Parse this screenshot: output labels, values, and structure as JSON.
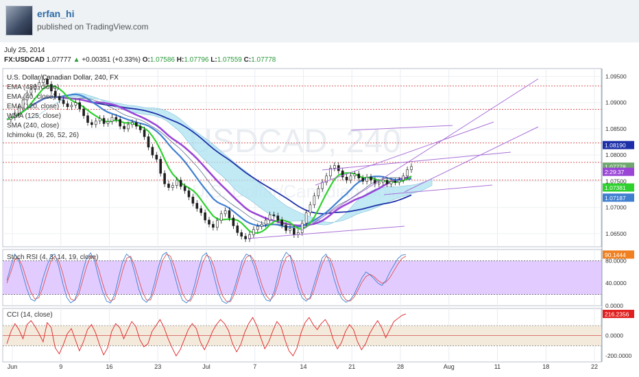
{
  "header": {
    "username": "erfan_hi",
    "published": "published on TradingView.com",
    "date": "July 25, 2014"
  },
  "quote": {
    "symbol": "FX:USDCAD",
    "last": "1.07777",
    "change": "+0.00351 (+0.33%)",
    "o_label": "O:",
    "o": "1.07586",
    "h_label": "H:",
    "h": "1.07796",
    "l_label": "L:",
    "l": "1.07559",
    "c_label": "C:",
    "c": "1.07778"
  },
  "pane_title": "U.S. Dollar/Canadian Dollar, 240, FX",
  "watermark": {
    "main": "USDCAD, 240",
    "sub": "U.S. Dollar/Canadian Dollar"
  },
  "indicators": [
    "EMA (480, close)",
    "EMA (40, close)",
    "EMA (120, close)",
    "WMA (125, close)",
    "SMA (240, close)",
    "Ichimoku (9, 26, 52, 26)"
  ],
  "stoch_title": "Stoch RSI (4, 3, 14, 19, close)",
  "cci_title": "CCI (14, close)",
  "colors": {
    "price": "#1e1e1e",
    "ema480": "#1c2fa8",
    "ema120": "#9a45d6",
    "ema40": "#2ed12e",
    "wma": "#3f7fd0",
    "sma": "#5a6f8a",
    "cloud": "#aee3f2",
    "level": "#cc2222",
    "trend": "#a86fd6",
    "stoch_fill": "#e2ccff",
    "cci_fill": "#f3eadc",
    "cci": "#e02020"
  },
  "chart_data": {
    "type": "line",
    "x_ticks": [
      "Jun",
      "9",
      "16",
      "23",
      "Jul",
      "7",
      "14",
      "21",
      "28",
      "Aug",
      "11",
      "18",
      "22"
    ],
    "price_axis": {
      "ticks": [
        "1.09500",
        "1.09000",
        "1.08500",
        "1.08000",
        "1.07500",
        "1.07000",
        "1.06500"
      ],
      "ylim": [
        1.0625,
        1.0965
      ],
      "labels": [
        {
          "text": "1.08190",
          "value": 1.0819,
          "color": "#1c2fa8"
        },
        {
          "text": "1.07778",
          "value": 1.07778,
          "color": "#6ea86e"
        },
        {
          "text": "2:29:37",
          "value": 1.0768,
          "color": "#9a45d6"
        },
        {
          "text": "1.07381",
          "value": 1.07381,
          "color": "#2ed12e"
        },
        {
          "text": "1.07187",
          "value": 1.07187,
          "color": "#3f7fd0"
        }
      ],
      "levels": [
        1.0932,
        1.0887,
        1.0823,
        1.0786,
        1.0752
      ]
    },
    "price_series": [
      1.0868,
      1.0872,
      1.088,
      1.089,
      1.0905,
      1.0918,
      1.0925,
      1.093,
      1.0938,
      1.0945,
      1.0935,
      1.0922,
      1.0912,
      1.0905,
      1.0898,
      1.0892,
      1.0895,
      1.09,
      1.0888,
      1.0875,
      1.0862,
      1.0858,
      1.0865,
      1.087,
      1.086,
      1.0864,
      1.0872,
      1.0868,
      1.0855,
      1.085,
      1.0858,
      1.0862,
      1.0855,
      1.0848,
      1.0835,
      1.0815,
      1.08,
      1.0792,
      1.0765,
      1.0745,
      1.0738,
      1.0742,
      1.0752,
      1.074,
      1.0732,
      1.072,
      1.0708,
      1.0698,
      1.069,
      1.0676,
      1.0668,
      1.0662,
      1.0675,
      1.0688,
      1.0694,
      1.068,
      1.0665,
      1.0652,
      1.0645,
      1.064,
      1.0648,
      1.0658,
      1.0664,
      1.0668,
      1.0676,
      1.0686,
      1.0684,
      1.0676,
      1.0666,
      1.0656,
      1.066,
      1.0648,
      1.0652,
      1.067,
      1.069,
      1.0705,
      1.0722,
      1.0736,
      1.0748,
      1.076,
      1.0775,
      1.078,
      1.077,
      1.0758,
      1.0752,
      1.076,
      1.0764,
      1.0756,
      1.075,
      1.0758,
      1.0752,
      1.0745,
      1.0748,
      1.0752,
      1.0745,
      1.075,
      1.0748,
      1.0752,
      1.076,
      1.0772,
      1.0778
    ],
    "stoch_rsi": {
      "ticks": [
        "80.0000",
        "40.0000",
        "0.0000"
      ],
      "ylim": [
        0,
        100
      ],
      "bands": [
        80,
        20
      ],
      "last_label": "90.1444",
      "k": [
        45,
        70,
        92,
        80,
        55,
        30,
        12,
        8,
        20,
        48,
        70,
        88,
        92,
        70,
        40,
        15,
        5,
        10,
        30,
        60,
        85,
        94,
        80,
        50,
        25,
        8,
        5,
        20,
        50,
        78,
        92,
        85,
        60,
        30,
        12,
        6,
        15,
        40,
        70,
        90,
        95,
        80,
        55,
        28,
        10,
        5,
        12,
        35,
        65,
        88,
        94,
        78,
        50,
        22,
        8,
        4,
        10,
        30,
        55,
        80,
        92,
        88,
        70,
        45,
        22,
        10,
        8,
        25,
        55,
        82,
        95,
        88,
        60,
        32,
        14,
        8,
        15,
        38,
        62,
        85,
        92,
        75,
        48,
        25,
        12,
        6,
        10,
        20,
        35,
        50,
        60,
        55,
        48,
        40,
        36,
        45,
        60,
        72,
        84,
        90,
        91
      ],
      "d": [
        40,
        60,
        82,
        84,
        68,
        45,
        25,
        12,
        14,
        32,
        56,
        78,
        88,
        80,
        58,
        30,
        12,
        9,
        20,
        45,
        70,
        88,
        86,
        65,
        40,
        18,
        8,
        12,
        35,
        62,
        84,
        88,
        72,
        48,
        25,
        10,
        10,
        28,
        55,
        80,
        92,
        88,
        70,
        45,
        22,
        10,
        8,
        22,
        48,
        75,
        90,
        86,
        68,
        40,
        18,
        8,
        7,
        20,
        45,
        68,
        86,
        90,
        80,
        58,
        35,
        18,
        10,
        18,
        40,
        68,
        86,
        90,
        75,
        48,
        25,
        12,
        12,
        28,
        52,
        74,
        88,
        84,
        65,
        40,
        20,
        10,
        8,
        15,
        28,
        42,
        52,
        56,
        52,
        45,
        40,
        42,
        50,
        62,
        74,
        84,
        88
      ]
    },
    "cci": {
      "ticks": [
        "0.0000",
        "-200.0000"
      ],
      "ylim": [
        -260,
        270
      ],
      "bands": [
        100,
        -100
      ],
      "last_label": "216.2356",
      "values": [
        -80,
        40,
        120,
        60,
        -30,
        110,
        150,
        90,
        20,
        -60,
        130,
        80,
        -120,
        -180,
        -90,
        20,
        70,
        -40,
        -150,
        -60,
        60,
        110,
        30,
        -90,
        -190,
        -120,
        40,
        120,
        80,
        -30,
        60,
        140,
        90,
        -40,
        -110,
        -80,
        40,
        100,
        160,
        80,
        -30,
        -120,
        -200,
        -140,
        -40,
        60,
        120,
        70,
        -60,
        -140,
        -60,
        40,
        110,
        160,
        120,
        50,
        -80,
        -160,
        -90,
        30,
        120,
        180,
        100,
        -20,
        -130,
        -60,
        50,
        140,
        90,
        -40,
        -150,
        -200,
        -120,
        30,
        130,
        180,
        110,
        60,
        120,
        160,
        90,
        -40,
        -130,
        -70,
        40,
        110,
        60,
        -60,
        -140,
        -80,
        20,
        90,
        150,
        80,
        -20,
        60,
        140,
        170,
        200,
        216
      ]
    }
  }
}
